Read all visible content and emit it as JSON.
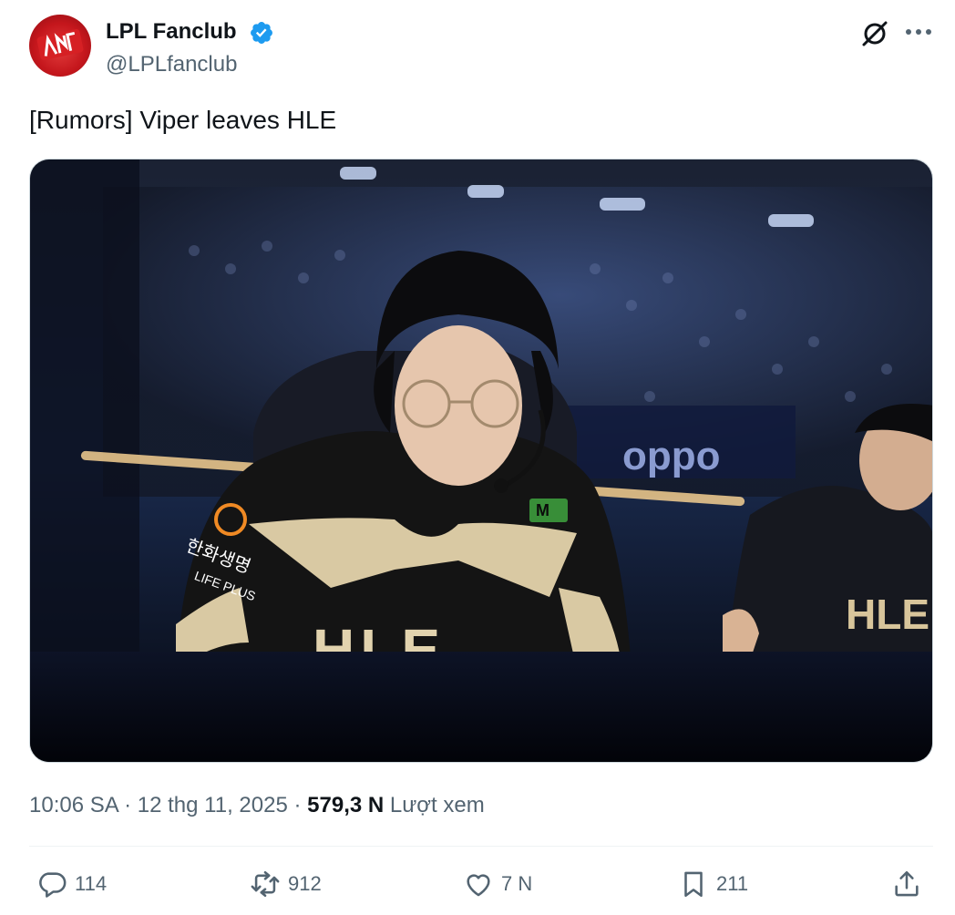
{
  "author": {
    "name": "LPL Fanclub",
    "handle": "@LPLfanclub",
    "verified": true,
    "verified_color": "#1d9bf0"
  },
  "tweet": {
    "text": "[Rumors] Viper leaves HLE",
    "time": "10:06 SA",
    "separator": "·",
    "date": "12 thg 11, 2025",
    "views_count": "579,3 N",
    "views_label": "Lượt xem"
  },
  "media": {
    "image_caption_text": [
      "HLE",
      "oppo",
      "한화생명",
      "LIFE PLUS"
    ]
  },
  "actions": {
    "replies": "114",
    "retweets": "912",
    "likes": "7 N",
    "bookmarks": "211"
  },
  "icons": [
    "grok-icon",
    "more-icon",
    "reply-icon",
    "retweet-icon",
    "like-icon",
    "bookmark-icon",
    "share-icon"
  ],
  "colors": {
    "text": "#0f1419",
    "secondary": "#536471",
    "accent": "#1d9bf0"
  }
}
